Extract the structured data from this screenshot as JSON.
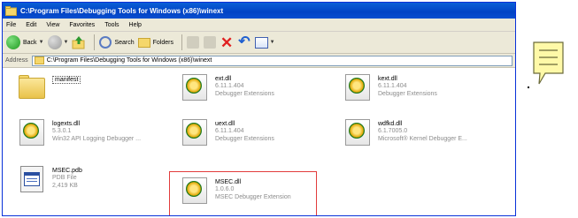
{
  "window": {
    "title": "C:\\Program Files\\Debugging Tools for Windows (x86)\\winext"
  },
  "menu": [
    "File",
    "Edit",
    "View",
    "Favorites",
    "Tools",
    "Help"
  ],
  "toolbar": {
    "back_label": "Back",
    "search_label": "Search",
    "folders_label": "Folders"
  },
  "address": {
    "label": "Address",
    "value": "C:\\Program Files\\Debugging Tools for Windows (x86)\\winext"
  },
  "files": [
    {
      "name": "manifest",
      "line1": "",
      "line2": "",
      "type": "folder"
    },
    {
      "name": "ext.dll",
      "line1": "6.11.1.404",
      "line2": "Debugger Extensions",
      "type": "dll"
    },
    {
      "name": "kext.dll",
      "line1": "6.11.1.404",
      "line2": "Debugger Extensions",
      "type": "dll"
    },
    {
      "name": "logexts.dll",
      "line1": "5.3.0.1",
      "line2": "Win32 API Logging Debugger ...",
      "type": "dll"
    },
    {
      "name": "uext.dll",
      "line1": "6.11.1.404",
      "line2": "Debugger Extensions",
      "type": "dll"
    },
    {
      "name": "wdfkd.dll",
      "line1": "6.1.7005.0",
      "line2": "Microsoft® Kernel Debugger E...",
      "type": "dll"
    },
    {
      "name": "MSEC.pdb",
      "line1": "PDB File",
      "line2": "2,419 KB",
      "type": "pdb"
    },
    {
      "name": "MSEC.dll",
      "line1": "1.0.6.0",
      "line2": "MSEC Debugger Extension",
      "type": "dll"
    }
  ],
  "highlighted_file": "MSEC.dll",
  "colors": {
    "titlebar": "#0a4fcf",
    "highlight_border": "#e23c3c",
    "note_fill": "#fff9a8"
  },
  "icons": {
    "note": "sticky-note-icon"
  }
}
